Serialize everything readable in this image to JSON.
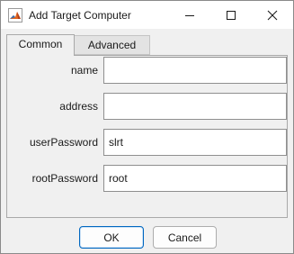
{
  "window": {
    "title": "Add Target Computer"
  },
  "titlebar": {
    "icon": "matlab-icon",
    "minimize_icon": "minimize-icon",
    "maximize_icon": "maximize-icon",
    "close_icon": "close-icon"
  },
  "tabs": [
    {
      "label": "Common",
      "selected": true
    },
    {
      "label": "Advanced",
      "selected": false
    }
  ],
  "fields": [
    {
      "label": "name",
      "value": ""
    },
    {
      "label": "address",
      "value": ""
    },
    {
      "label": "userPassword",
      "value": "slrt"
    },
    {
      "label": "rootPassword",
      "value": "root"
    }
  ],
  "buttons": {
    "ok_label": "OK",
    "cancel_label": "Cancel"
  },
  "colors": {
    "accent": "#0067c0",
    "window_bg": "#f0f0f0"
  }
}
